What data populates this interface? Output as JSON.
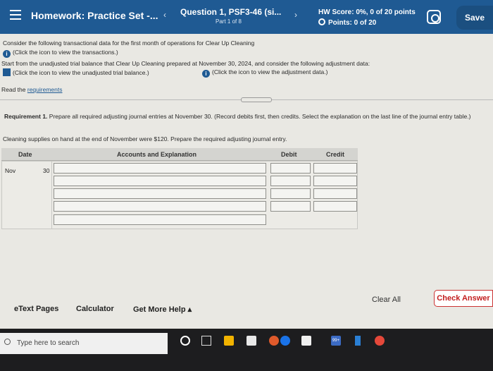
{
  "header": {
    "homework_title": "Homework: Practice Set -...",
    "question_title": "Question 1, PSF3-46 (si...",
    "question_part": "Part 1 of 8",
    "hw_score": "HW Score: 0%, 0 of 20 points",
    "points": "Points: 0 of 20",
    "save_label": "Save",
    "prev_glyph": "‹",
    "next_glyph": "›",
    "icons": [
      "menu-icon",
      "settings-icon"
    ],
    "bar_color": "#1f5a93"
  },
  "content": {
    "intro": "Consider the following transactional data for the first month of operations for Clear Up Cleaning",
    "transactions_link": "(Click the icon to view the transactions.)",
    "trial_balance_intro": "Start from the unadjusted trial balance that Clear Up Cleaning prepared at November 30, 2024, and consider the following adjustment data:",
    "trial_balance_link": "(Click the icon to view the unadjusted trial balance.)",
    "adjustment_link": "(Click the icon to view the adjustment data.)",
    "read_prefix": "Read the",
    "requirements_link": "requirements",
    "requirement_label": "Requirement 1.",
    "requirement_text": "Prepare all required adjusting journal entries at November 30. (Record debits first, then credits. Select the explanation on the last line of the journal entry table.)",
    "prompt": "Cleaning supplies on hand at the end of November were $120. Prepare the required adjusting journal entry."
  },
  "journal": {
    "headers": {
      "date": "Date",
      "accounts": "Accounts and Explanation",
      "debit": "Debit",
      "credit": "Credit"
    },
    "month": "Nov",
    "day": "30",
    "rows": 5
  },
  "footer": {
    "etext": "eText Pages",
    "calculator": "Calculator",
    "get_more_help": "Get More Help ▴",
    "clear_all": "Clear All",
    "check_answer": "Check Answer",
    "check_color": "#c21e1e"
  },
  "taskbar": {
    "search_placeholder": "Type here to search",
    "badge": "99+"
  }
}
